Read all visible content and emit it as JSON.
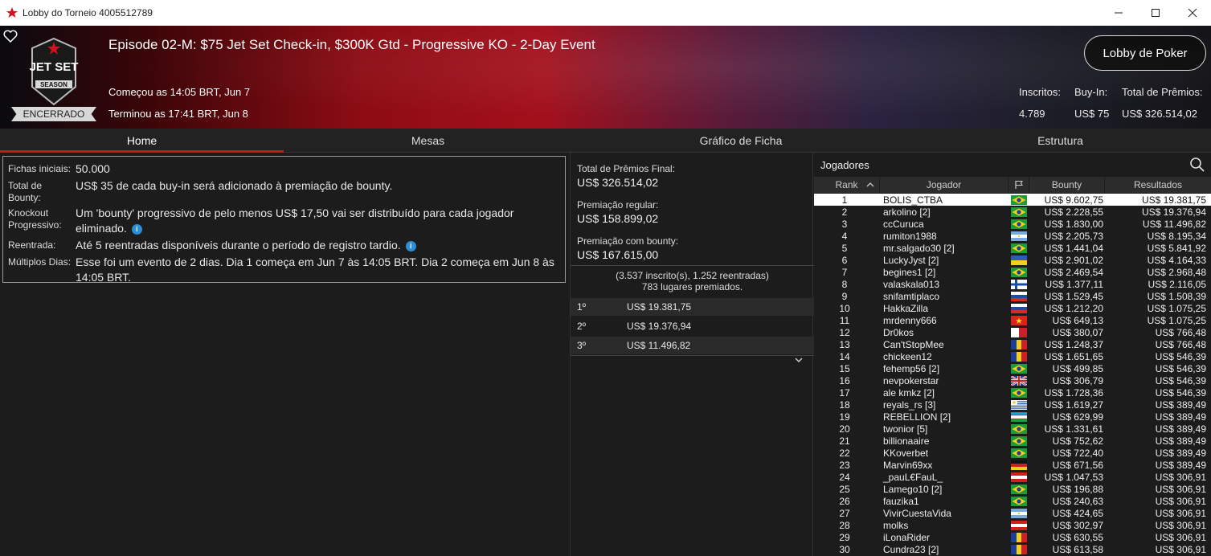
{
  "window": {
    "title": "Lobby do Torneio 4005512789"
  },
  "header": {
    "event_title": "Episode 02-M: $75 Jet Set Check-in, $300K Gtd - Progressive KO - 2-Day Event",
    "started": "Começou as 14:05 BRT, Jun 7",
    "ended": "Terminou as 17:41 BRT, Jun 8",
    "status": "ENCERRADO",
    "lobby_button": "Lobby de Poker",
    "logo_text_1": "JET SET",
    "logo_text_2": "SEASON",
    "stats": {
      "entrants_label": "Inscritos:",
      "entrants_value": "4.789",
      "buyin_label": "Buy-In:",
      "buyin_value": "US$ 75",
      "prize_label": "Total de Prêmios:",
      "prize_value": "US$ 326.514,02"
    }
  },
  "tabs": [
    {
      "label": "Home"
    },
    {
      "label": "Mesas"
    },
    {
      "label": "Gráfico de Ficha"
    },
    {
      "label": "Estrutura"
    }
  ],
  "info": {
    "rows": [
      {
        "label": "Fichas iniciais:",
        "value": "50.000"
      },
      {
        "label": "Total de Bounty:",
        "value": "US$ 35 de cada buy-in será adicionado à premiação de bounty."
      },
      {
        "label": "Knockout Progressivo:",
        "value": "Um 'bounty' progressivo de pelo menos US$ 17,50 vai ser distribuído para cada jogador eliminado."
      },
      {
        "label": "Reentrada:",
        "value": "Até 5 reentradas disponíveis durante o período de registro tardio."
      },
      {
        "label": "Múltiplos Dias:",
        "value": "Esse foi um evento de 2 dias. Dia 1 começa em Jun 7 às 14:05 BRT. Dia 2 começa em Jun 8 às 14:05 BRT."
      }
    ]
  },
  "prizes": {
    "final_label": "Total de Prêmios Final:",
    "final_value": "US$ 326.514,02",
    "regular_label": "Premiação regular:",
    "regular_value": "US$ 158.899,02",
    "bounty_label": "Premiação com bounty:",
    "bounty_value": "US$ 167.615,00",
    "summary_1": "(3.537 inscrito(s), 1.252 reentradas)",
    "summary_2": "783 lugares premiados.",
    "places": [
      {
        "pos": "1º",
        "amount": "US$ 19.381,75"
      },
      {
        "pos": "2º",
        "amount": "US$ 19.376,94"
      },
      {
        "pos": "3º",
        "amount": "US$ 11.496,82"
      }
    ]
  },
  "players": {
    "title": "Jogadores",
    "headers": {
      "rank": "Rank",
      "player": "Jogador",
      "bounty": "Bounty",
      "results": "Resultados"
    },
    "rows": [
      {
        "rank": "1",
        "name": "BOLIS_CTBA",
        "flag": "br",
        "bounty": "US$ 9.602,75",
        "result": "US$ 19.381,75"
      },
      {
        "rank": "2",
        "name": "arkolino [2]",
        "flag": "br",
        "bounty": "US$ 2.228,55",
        "result": "US$ 19.376,94"
      },
      {
        "rank": "3",
        "name": "ccCuruca",
        "flag": "br",
        "bounty": "US$ 1.830,00",
        "result": "US$ 11.496,82"
      },
      {
        "rank": "4",
        "name": "rumiton1988",
        "flag": "ar",
        "bounty": "US$ 2.205,73",
        "result": "US$ 8.195,34"
      },
      {
        "rank": "5",
        "name": "mr.salgado30 [2]",
        "flag": "br",
        "bounty": "US$ 1.441,04",
        "result": "US$ 5.841,92"
      },
      {
        "rank": "6",
        "name": "LuckyJyst [2]",
        "flag": "ua",
        "bounty": "US$ 2.901,02",
        "result": "US$ 4.164,33"
      },
      {
        "rank": "7",
        "name": "begines1 [2]",
        "flag": "br",
        "bounty": "US$ 2.469,54",
        "result": "US$ 2.968,48"
      },
      {
        "rank": "8",
        "name": "valaskala013",
        "flag": "fi",
        "bounty": "US$ 1.377,11",
        "result": "US$ 2.116,05"
      },
      {
        "rank": "9",
        "name": "snifamtiplaco",
        "flag": "si",
        "bounty": "US$ 1.529,45",
        "result": "US$ 1.508,39"
      },
      {
        "rank": "10",
        "name": "HakkaZilla",
        "flag": "si",
        "bounty": "US$ 1.212,20",
        "result": "US$ 1.075,25"
      },
      {
        "rank": "11",
        "name": "mrdenny666",
        "flag": "vn",
        "bounty": "US$ 649,13",
        "result": "US$ 1.075,25"
      },
      {
        "rank": "12",
        "name": "Dr0kos",
        "flag": "mt",
        "bounty": "US$ 380,07",
        "result": "US$ 766,48"
      },
      {
        "rank": "13",
        "name": "Can'tStopMee",
        "flag": "ro",
        "bounty": "US$ 1.248,37",
        "result": "US$ 766,48"
      },
      {
        "rank": "14",
        "name": "chickeen12",
        "flag": "ro",
        "bounty": "US$ 1.651,65",
        "result": "US$ 546,39"
      },
      {
        "rank": "15",
        "name": "fehemp56 [2]",
        "flag": "br",
        "bounty": "US$ 499,85",
        "result": "US$ 546,39"
      },
      {
        "rank": "16",
        "name": "nevpokerstar",
        "flag": "gb",
        "bounty": "US$ 306,79",
        "result": "US$ 546,39"
      },
      {
        "rank": "17",
        "name": "ale kmkz [2]",
        "flag": "br",
        "bounty": "US$ 1.728,36",
        "result": "US$ 546,39"
      },
      {
        "rank": "18",
        "name": "reyals_rs [3]",
        "flag": "uy",
        "bounty": "US$ 1.619,27",
        "result": "US$ 389,49"
      },
      {
        "rank": "19",
        "name": "REBELLION [2]",
        "flag": "uz",
        "bounty": "US$ 629,99",
        "result": "US$ 389,49"
      },
      {
        "rank": "20",
        "name": "twonior [5]",
        "flag": "br",
        "bounty": "US$ 1.331,61",
        "result": "US$ 389,49"
      },
      {
        "rank": "21",
        "name": "billionaaire",
        "flag": "br",
        "bounty": "US$ 752,62",
        "result": "US$ 389,49"
      },
      {
        "rank": "22",
        "name": "KKoverbet",
        "flag": "br",
        "bounty": "US$ 722,40",
        "result": "US$ 389,49"
      },
      {
        "rank": "23",
        "name": "Marvin69xx",
        "flag": "de",
        "bounty": "US$ 671,56",
        "result": "US$ 389,49"
      },
      {
        "rank": "24",
        "name": "_pauL€FauL_",
        "flag": "at",
        "bounty": "US$ 1.047,53",
        "result": "US$ 306,91"
      },
      {
        "rank": "25",
        "name": "Lamego10 [2]",
        "flag": "br",
        "bounty": "US$ 196,88",
        "result": "US$ 306,91"
      },
      {
        "rank": "26",
        "name": "fauzika1",
        "flag": "br",
        "bounty": "US$ 240,63",
        "result": "US$ 306,91"
      },
      {
        "rank": "27",
        "name": "VivirCuestaVida",
        "flag": "ar",
        "bounty": "US$ 424,65",
        "result": "US$ 306,91"
      },
      {
        "rank": "28",
        "name": "molks",
        "flag": "at",
        "bounty": "US$ 302,97",
        "result": "US$ 306,91"
      },
      {
        "rank": "29",
        "name": "iLonaRider",
        "flag": "ro",
        "bounty": "US$ 630,55",
        "result": "US$ 306,91"
      },
      {
        "rank": "30",
        "name": "Cundra23 [2]",
        "flag": "ro",
        "bounty": "US$ 613,58",
        "result": "US$ 306,91"
      }
    ]
  },
  "colors": {
    "accent": "#d4111e",
    "selected_row": "#ffffff"
  }
}
